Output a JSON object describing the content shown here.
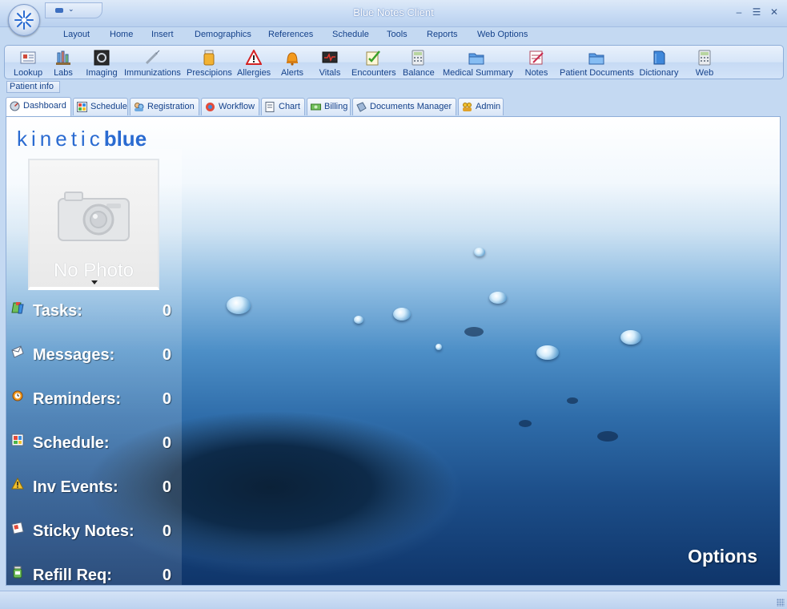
{
  "window": {
    "title": "Blue Notes Client"
  },
  "menu": [
    {
      "label": "Layout"
    },
    {
      "label": "Home"
    },
    {
      "label": "Insert"
    },
    {
      "label": "Demographics"
    },
    {
      "label": "References"
    },
    {
      "label": "Schedule"
    },
    {
      "label": "Tools"
    },
    {
      "label": "Reports"
    },
    {
      "label": "Web Options"
    }
  ],
  "ribbon": [
    {
      "label": "Lookup",
      "icon": "lookup-icon"
    },
    {
      "label": "Labs",
      "icon": "labs-icon"
    },
    {
      "label": "Imaging",
      "icon": "imaging-icon"
    },
    {
      "label": "Immunizations",
      "icon": "syringe-icon"
    },
    {
      "label": "Prescipions",
      "icon": "pill-bottle-icon"
    },
    {
      "label": "Allergies",
      "icon": "warning-icon"
    },
    {
      "label": "Alerts",
      "icon": "bell-icon"
    },
    {
      "label": "Vitals",
      "icon": "monitor-icon"
    },
    {
      "label": "Encounters",
      "icon": "checklist-icon"
    },
    {
      "label": "Balance",
      "icon": "calculator-icon"
    },
    {
      "label": "Medical Summary",
      "icon": "folder-icon"
    },
    {
      "label": "Notes",
      "icon": "notes-icon"
    },
    {
      "label": "Patient Documents",
      "icon": "folder-icon"
    },
    {
      "label": "Dictionary",
      "icon": "dictionary-icon"
    },
    {
      "label": "Web",
      "icon": "web-icon"
    }
  ],
  "patient_info": {
    "label": "Patient info"
  },
  "tabs": [
    {
      "label": "Dashboard",
      "icon": "dashboard-icon",
      "active": true
    },
    {
      "label": "Schedule",
      "icon": "schedule-icon"
    },
    {
      "label": "Registration",
      "icon": "registration-icon"
    },
    {
      "label": "Workflow",
      "icon": "workflow-icon"
    },
    {
      "label": "Chart",
      "icon": "chart-icon"
    },
    {
      "label": "Billing",
      "icon": "billing-icon"
    },
    {
      "label": "Documents Manager",
      "icon": "documents-icon"
    },
    {
      "label": "Admin",
      "icon": "admin-icon"
    }
  ],
  "dashboard": {
    "logo_light": "kinetic",
    "logo_bold": "blue",
    "photo_label": "No Photo",
    "stats": [
      {
        "label": "Tasks:",
        "value": "0",
        "icon": "tasks-icon"
      },
      {
        "label": "Messages:",
        "value": "0",
        "icon": "envelope-icon"
      },
      {
        "label": "Reminders:",
        "value": "0",
        "icon": "reminder-icon"
      },
      {
        "label": "Schedule:",
        "value": "0",
        "icon": "schedule-grid-icon"
      },
      {
        "label": "Inv Events:",
        "value": "0",
        "icon": "warning-icon"
      },
      {
        "label": "Sticky Notes:",
        "value": "0",
        "icon": "sticky-note-icon"
      },
      {
        "label": "Refill Req:",
        "value": "0",
        "icon": "refill-icon"
      }
    ],
    "options_label": "Options"
  },
  "colors": {
    "accent": "#15428b",
    "logo": "#2a6bd1",
    "water": "#2f6daa"
  }
}
